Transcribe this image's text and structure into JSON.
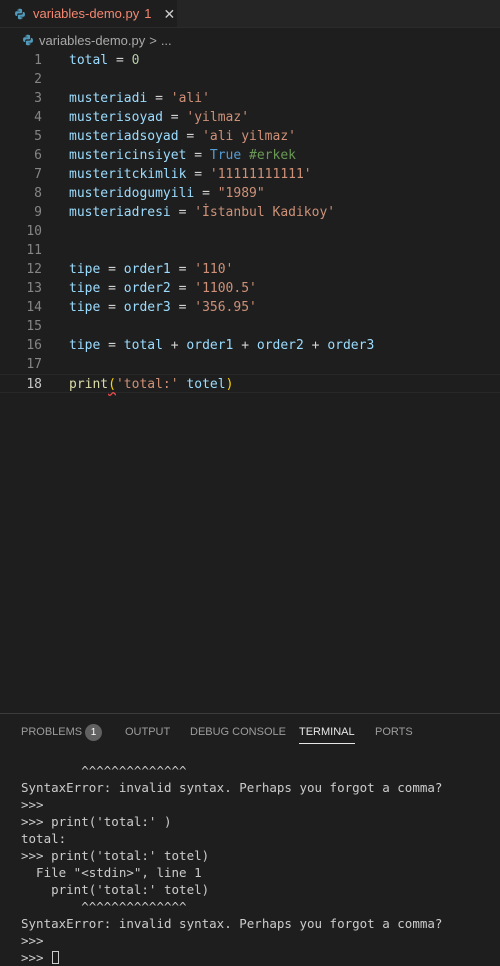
{
  "tab": {
    "filename": "variables-demo.py",
    "problem_count": "1",
    "close_symbol": "✕",
    "icon": "python-icon"
  },
  "breadcrumb": {
    "filename": "variables-demo.py",
    "separator": ">",
    "more": "..."
  },
  "editor": {
    "current_line": 18,
    "lines": [
      {
        "n": "1"
      },
      {
        "n": "2"
      },
      {
        "n": "3"
      },
      {
        "n": "4"
      },
      {
        "n": "5"
      },
      {
        "n": "6"
      },
      {
        "n": "7"
      },
      {
        "n": "8"
      },
      {
        "n": "9"
      },
      {
        "n": "10"
      },
      {
        "n": "11"
      },
      {
        "n": "12"
      },
      {
        "n": "13"
      },
      {
        "n": "14"
      },
      {
        "n": "15"
      },
      {
        "n": "16"
      },
      {
        "n": "17"
      },
      {
        "n": "18"
      }
    ],
    "tokens": {
      "l1": [
        "total",
        "=",
        "0"
      ],
      "l3": [
        "musteriadi",
        "=",
        "'ali'"
      ],
      "l4": [
        "musterisoyad",
        "=",
        "'yilmaz'"
      ],
      "l5": [
        "musteriadsoyad",
        "=",
        "'ali yilmaz'"
      ],
      "l6": [
        "mustericinsiyet",
        "=",
        "True",
        "#erkek"
      ],
      "l7": [
        "musteritckimlik",
        "=",
        "'11111111111'"
      ],
      "l8": [
        "musteridogumyili",
        "=",
        "\"1989\""
      ],
      "l9": [
        "musteriadresi",
        "=",
        "'İstanbul Kadikoy'"
      ],
      "l12": [
        "tipe",
        "=",
        "order1",
        "=",
        "'110'"
      ],
      "l13": [
        "tipe",
        "=",
        "order2",
        "=",
        "'1100.5'"
      ],
      "l14": [
        "tipe",
        "=",
        "order3",
        "=",
        "'356.95'"
      ],
      "l16": [
        "tipe",
        "=",
        "total",
        "+",
        "order1",
        "+",
        "order2",
        "+",
        "order3"
      ],
      "l18": [
        "print",
        "(",
        "'total:'",
        "totel",
        ")"
      ]
    }
  },
  "panel": {
    "tabs": [
      {
        "label": "PROBLEMS",
        "badge": "1"
      },
      {
        "label": "OUTPUT"
      },
      {
        "label": "DEBUG CONSOLE"
      },
      {
        "label": "TERMINAL",
        "active": true
      },
      {
        "label": "PORTS"
      }
    ],
    "terminal_lines": [
      "        ^^^^^^^^^^^^^^",
      "SyntaxError: invalid syntax. Perhaps you forgot a comma?",
      ">>>",
      ">>> print('total:' )",
      "total:",
      ">>> print('total:' totel)",
      "  File \"<stdin>\", line 1",
      "    print('total:' totel)",
      "        ^^^^^^^^^^^^^^",
      "SyntaxError: invalid syntax. Perhaps you forgot a comma?",
      ">>>",
      ">>> "
    ]
  }
}
